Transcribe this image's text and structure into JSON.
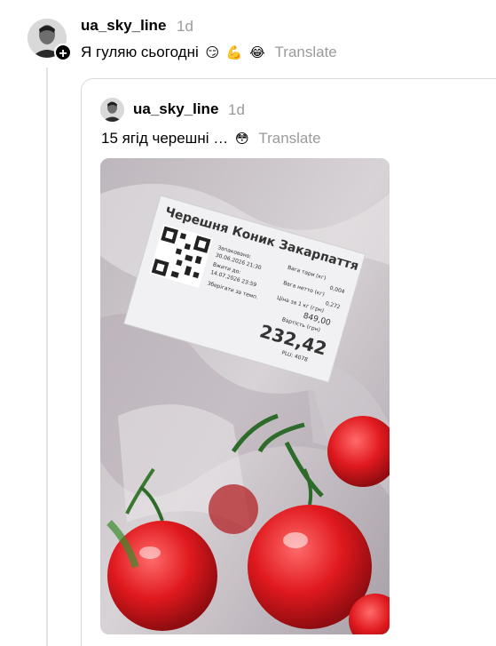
{
  "post": {
    "username": "ua_sky_line",
    "time": "1d",
    "text": "Я гуляю сьогодні",
    "emojis": [
      "😏",
      "💪",
      "😂"
    ],
    "translate_label": "Translate",
    "follow_symbol": "+"
  },
  "quote": {
    "username": "ua_sky_line",
    "time": "1d",
    "text": "15 ягід черешні …",
    "emoji": "😳",
    "translate_label": "Translate"
  },
  "image_label": {
    "product": "Черешня Коник Закарпаття",
    "packed_label": "Запаковано:",
    "packed_date": "30.06.2026 21:30",
    "use_by_label": "Вжити до:",
    "use_by_date": "14.07.2026 23:59",
    "storage": "Зберігати за темп.",
    "tare_weight_label": "Вага тари (кг)",
    "tare_weight": "0,004",
    "net_weight_label": "Вага нетто (кг)",
    "net_weight": "0,272",
    "price_per_kg_label": "Ціна за 1 кг (грн)",
    "price_per_kg": "849,00",
    "cost_label": "Вартість (грн)",
    "cost": "232,42",
    "plu": "PLU: 4078"
  }
}
